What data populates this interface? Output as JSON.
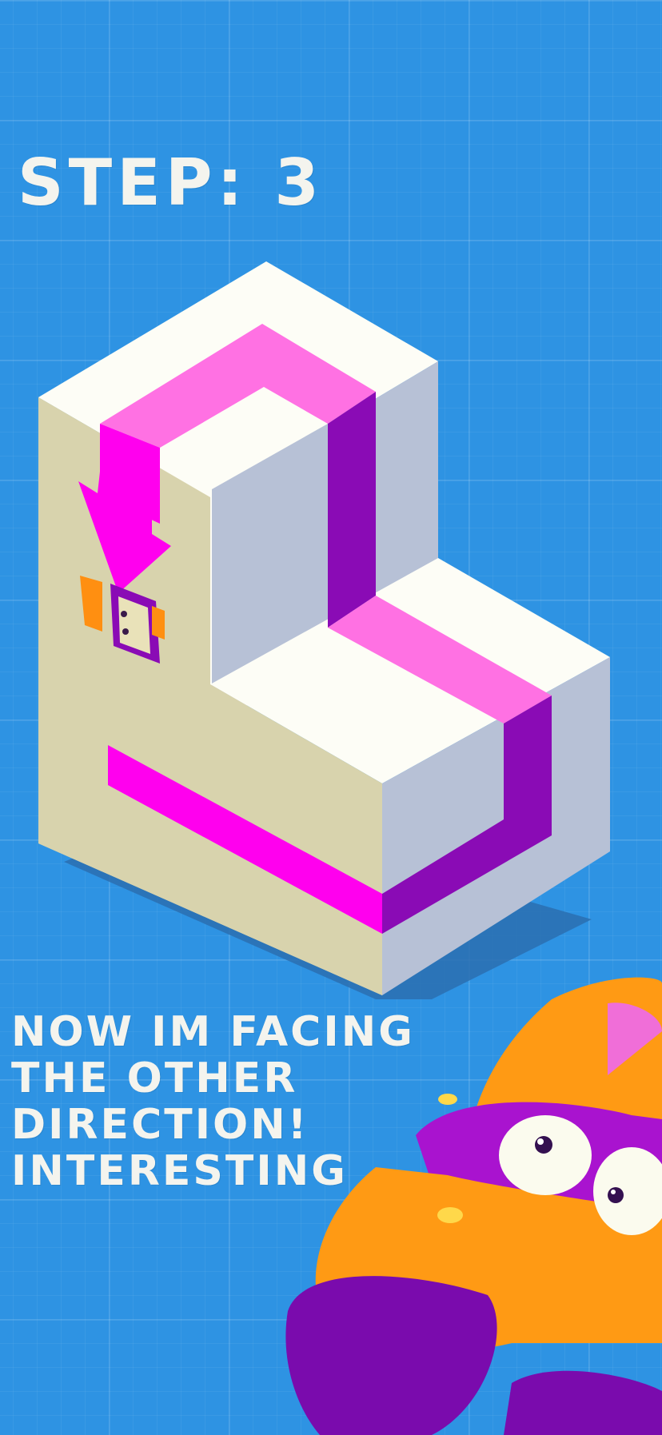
{
  "hud": {
    "step_label": "STEP: 3"
  },
  "dialogue": {
    "lines": [
      "NOW IM FACING",
      "THE OTHER",
      "DIRECTION!",
      "INTERESTING"
    ]
  },
  "colors": {
    "background": "#2e93e3",
    "block_top": "#fdfdf6",
    "block_left": "#d8d3ad",
    "block_right": "#b7c1d6",
    "path_top": "#ff71e3",
    "path_left": "#ff00ee",
    "path_right": "#8a0bb5",
    "character_orange": "#ff9a14",
    "character_purple": "#9a0fc4"
  },
  "icons": {
    "direction_arrow": "arrow-down-icon",
    "player": "player-character-icon",
    "mascot": "mascot-character-icon"
  }
}
